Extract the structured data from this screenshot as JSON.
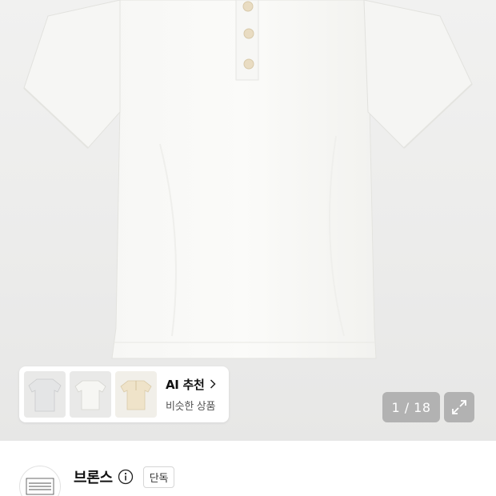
{
  "product_image": {
    "alt_icon": "shirt-image"
  },
  "ai_recommend": {
    "title": "AI 추천",
    "subtitle": "비슷한 상품",
    "thumbnails": [
      "gray-tshirt-thumb",
      "white-tshirt-thumb",
      "beige-henley-thumb"
    ]
  },
  "gallery": {
    "counter": "1 / 18"
  },
  "brand": {
    "name": "브론스",
    "badge": "단독",
    "logo_icon": "brand-logo"
  },
  "colors": {
    "accent_overlay": "#a0a0a0",
    "text_primary": "#111111"
  }
}
